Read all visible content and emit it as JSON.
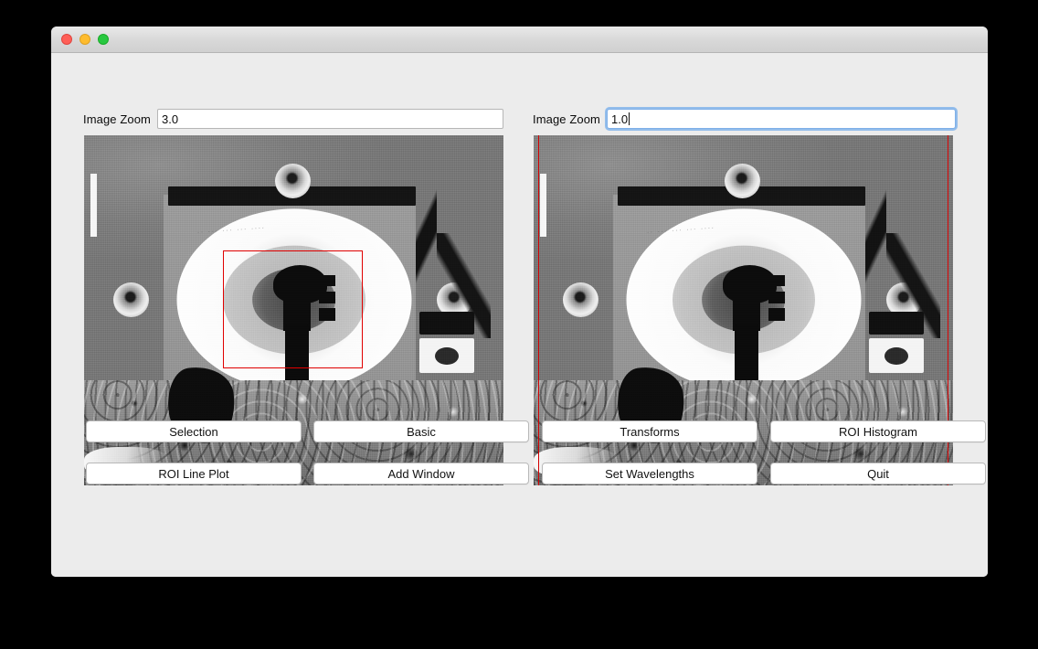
{
  "window": {
    "title": "",
    "traffic_lights": [
      {
        "name": "close",
        "color": "#ff5f57"
      },
      {
        "name": "minimize",
        "color": "#febc2e"
      },
      {
        "name": "zoom",
        "color": "#28c840"
      }
    ]
  },
  "panels": [
    {
      "id": "left",
      "zoom_label": "Image Zoom",
      "zoom_value": "3.0",
      "zoom_placeholder": "",
      "focused": false,
      "roi": {
        "type": "rectangle",
        "color": "#e00000",
        "left_pct": 33.1,
        "top_pct": 32.9,
        "width_pct": 33.3,
        "height_pct": 33.7
      }
    },
    {
      "id": "right",
      "zoom_label": "Image Zoom",
      "zoom_value": "1.0",
      "zoom_placeholder": "",
      "focused": true,
      "roi": {
        "type": "vertical-lines",
        "color": "#d40000",
        "left_pct": 1.1,
        "right_pct": 1.1
      }
    }
  ],
  "image_caption": {
    "engraving": "..  ...  ... ...      ....",
    "subject": "grayscale calibration target with gnomon and shadow post over rocky terrain"
  },
  "buttons": {
    "row1": [
      {
        "name": "selection",
        "label": "Selection"
      },
      {
        "name": "basic",
        "label": "Basic"
      },
      {
        "name": "transforms",
        "label": "Transforms"
      },
      {
        "name": "roi-histogram",
        "label": "ROI Histogram"
      }
    ],
    "row2": [
      {
        "name": "roi-line-plot",
        "label": "ROI Line Plot"
      },
      {
        "name": "add-window",
        "label": "Add Window"
      },
      {
        "name": "set-wavelengths",
        "label": "Set Wavelengths"
      },
      {
        "name": "quit",
        "label": "Quit"
      }
    ]
  },
  "colors": {
    "window_bg": "#ececec",
    "titlebar_top": "#e9e9e9",
    "titlebar_bottom": "#d0d0d0",
    "desktop_bg": "#000000",
    "focus_ring": "#7fb0e8",
    "roi_red": "#e00000",
    "button_bg": "#ffffff",
    "button_border": "#b9b9b9"
  }
}
